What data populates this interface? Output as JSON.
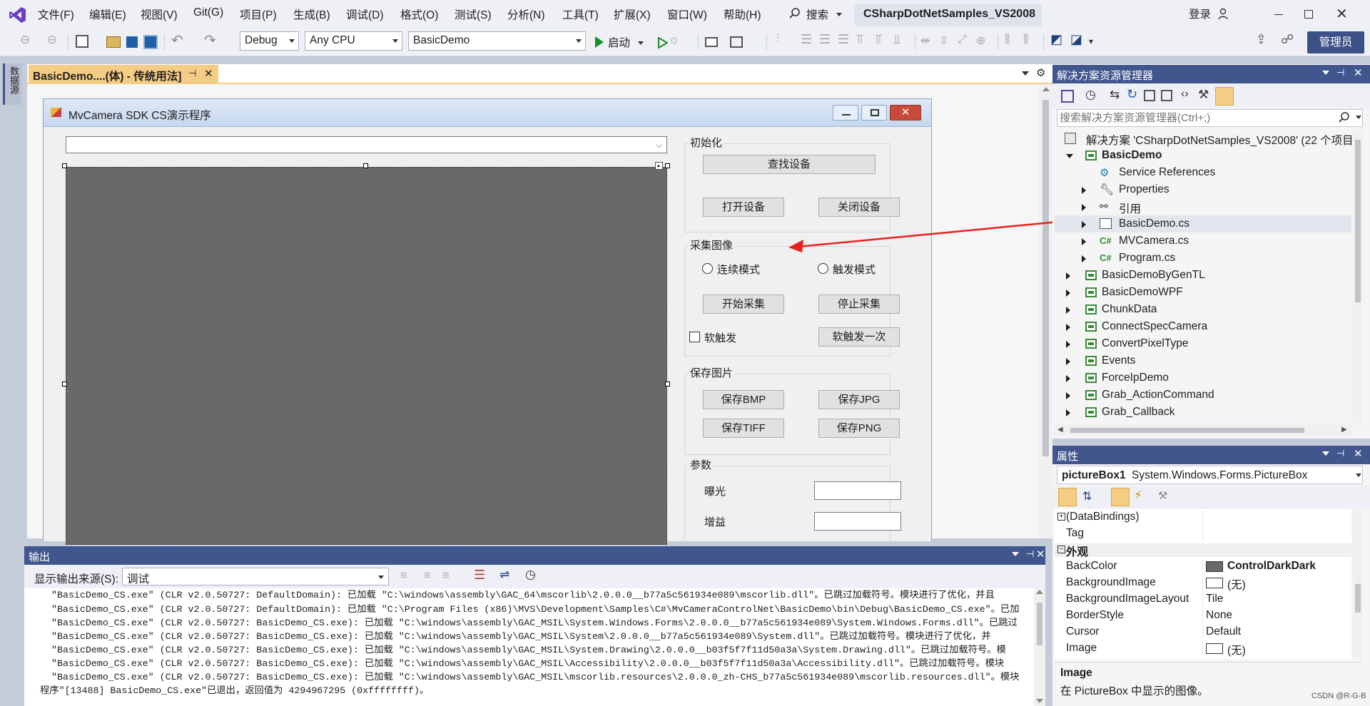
{
  "menu": {
    "items": [
      "文件(F)",
      "编辑(E)",
      "视图(V)",
      "Git(G)",
      "项目(P)",
      "生成(B)",
      "调试(D)",
      "格式(O)",
      "测试(S)",
      "分析(N)",
      "工具(T)",
      "扩展(X)",
      "窗口(W)",
      "帮助(H)"
    ],
    "search_label": "搜索",
    "solution_title": "CSharpDotNetSamples_VS2008",
    "login": "登录",
    "admin": "管理员"
  },
  "toolbar": {
    "config": "Debug",
    "platform": "Any CPU",
    "startup_project": "BasicDemo",
    "start_label": "启动"
  },
  "left_strip": {
    "label": "数据源"
  },
  "designer": {
    "tab_title": "BasicDemo....(体) - 传统用法]",
    "form_title": "MvCamera SDK CS演示程序",
    "groups": {
      "init": {
        "label": "初始化",
        "find_device": "查找设备",
        "open_device": "打开设备",
        "close_device": "关闭设备"
      },
      "capture": {
        "label": "采集图像",
        "continuous_mode": "连续模式",
        "trigger_mode": "触发模式",
        "start_grab": "开始采集",
        "stop_grab": "停止采集",
        "soft_trigger": "软触发",
        "soft_trigger_once": "软触发一次"
      },
      "save": {
        "label": "保存图片",
        "bmp": "保存BMP",
        "jpg": "保存JPG",
        "tiff": "保存TIFF",
        "png": "保存PNG"
      },
      "params": {
        "label": "参数",
        "exposure": "曝光",
        "gain": "增益"
      }
    }
  },
  "solution_explorer": {
    "title": "解决方案资源管理器",
    "search_placeholder": "搜索解决方案资源管理器(Ctrl+;)",
    "items": [
      {
        "label": "解决方案 'CSharpDotNetSamples_VS2008' (22 个项目",
        "indent": 0
      },
      {
        "label": "BasicDemo",
        "indent": 1
      },
      {
        "label": "Service References",
        "indent": 2
      },
      {
        "label": "Properties",
        "indent": 2
      },
      {
        "label": "引用",
        "indent": 2
      },
      {
        "label": "BasicDemo.cs",
        "indent": 2
      },
      {
        "label": "MVCamera.cs",
        "indent": 2
      },
      {
        "label": "Program.cs",
        "indent": 2
      },
      {
        "label": "BasicDemoByGenTL",
        "indent": 1
      },
      {
        "label": "BasicDemoWPF",
        "indent": 1
      },
      {
        "label": "ChunkData",
        "indent": 1
      },
      {
        "label": "ConnectSpecCamera",
        "indent": 1
      },
      {
        "label": "ConvertPixelType",
        "indent": 1
      },
      {
        "label": "Events",
        "indent": 1
      },
      {
        "label": "ForceIpDemo",
        "indent": 1
      },
      {
        "label": "Grab_ActionCommand",
        "indent": 1
      },
      {
        "label": "Grab_Callback",
        "indent": 1
      }
    ]
  },
  "properties": {
    "title": "属性",
    "object_name": "pictureBox1",
    "object_type": "System.Windows.Forms.PictureBox",
    "rows": [
      {
        "name": "(DataBindings)",
        "value": ""
      },
      {
        "name": "Tag",
        "value": ""
      },
      {
        "name": "外观",
        "value": ""
      },
      {
        "name": "BackColor",
        "value": "ControlDarkDark"
      },
      {
        "name": "BackgroundImage",
        "value": "(无)"
      },
      {
        "name": "BackgroundImageLayout",
        "value": "Tile"
      },
      {
        "name": "BorderStyle",
        "value": "None"
      },
      {
        "name": "Cursor",
        "value": "Default"
      },
      {
        "name": "Image",
        "value": "(无)"
      }
    ],
    "desc_title": "Image",
    "desc_text": "在 PictureBox 中显示的图像。"
  },
  "output": {
    "title": "输出",
    "source_label": "显示输出来源(S):",
    "source_value": "调试",
    "lines": [
      "\"BasicDemo_CS.exe\" (CLR v2.0.50727: DefaultDomain): 已加载 \"C:\\windows\\assembly\\GAC_64\\mscorlib\\2.0.0.0__b77a5c561934e089\\mscorlib.dll\"。已跳过加载符号。模块进行了优化，并且",
      "\"BasicDemo_CS.exe\" (CLR v2.0.50727: DefaultDomain): 已加载 \"C:\\Program Files (x86)\\MVS\\Development\\Samples\\C#\\MvCameraControlNet\\BasicDemo\\bin\\Debug\\BasicDemo_CS.exe\"。已加",
      "\"BasicDemo_CS.exe\" (CLR v2.0.50727: BasicDemo_CS.exe): 已加载 \"C:\\windows\\assembly\\GAC_MSIL\\System.Windows.Forms\\2.0.0.0__b77a5c561934e089\\System.Windows.Forms.dll\"。已跳过",
      "\"BasicDemo_CS.exe\" (CLR v2.0.50727: BasicDemo_CS.exe): 已加载 \"C:\\windows\\assembly\\GAC_MSIL\\System\\2.0.0.0__b77a5c561934e089\\System.dll\"。已跳过加载符号。模块进行了优化，并",
      "\"BasicDemo_CS.exe\" (CLR v2.0.50727: BasicDemo_CS.exe): 已加载 \"C:\\windows\\assembly\\GAC_MSIL\\System.Drawing\\2.0.0.0__b03f5f7f11d50a3a\\System.Drawing.dll\"。已跳过加载符号。模",
      "\"BasicDemo_CS.exe\" (CLR v2.0.50727: BasicDemo_CS.exe): 已加载 \"C:\\windows\\assembly\\GAC_MSIL\\Accessibility\\2.0.0.0__b03f5f7f11d50a3a\\Accessibility.dll\"。已跳过加载符号。模块",
      "\"BasicDemo_CS.exe\" (CLR v2.0.50727: BasicDemo_CS.exe): 已加载 \"C:\\windows\\assembly\\GAC_MSIL\\mscorlib.resources\\2.0.0.0_zh-CHS_b77a5c561934e089\\mscorlib.resources.dll\"。模块",
      "程序\"[13488] BasicDemo_CS.exe\"已退出，返回值为 4294967295 (0xffffffff)。"
    ]
  },
  "watermark": "CSDN @R-G-B",
  "colors": {
    "vs_purple": "#6c3fbf",
    "panel_header": "#40568d",
    "tab_active": "#f5cc84",
    "arrow_red": "#e8211d",
    "picturebox_gray": "#696969"
  }
}
